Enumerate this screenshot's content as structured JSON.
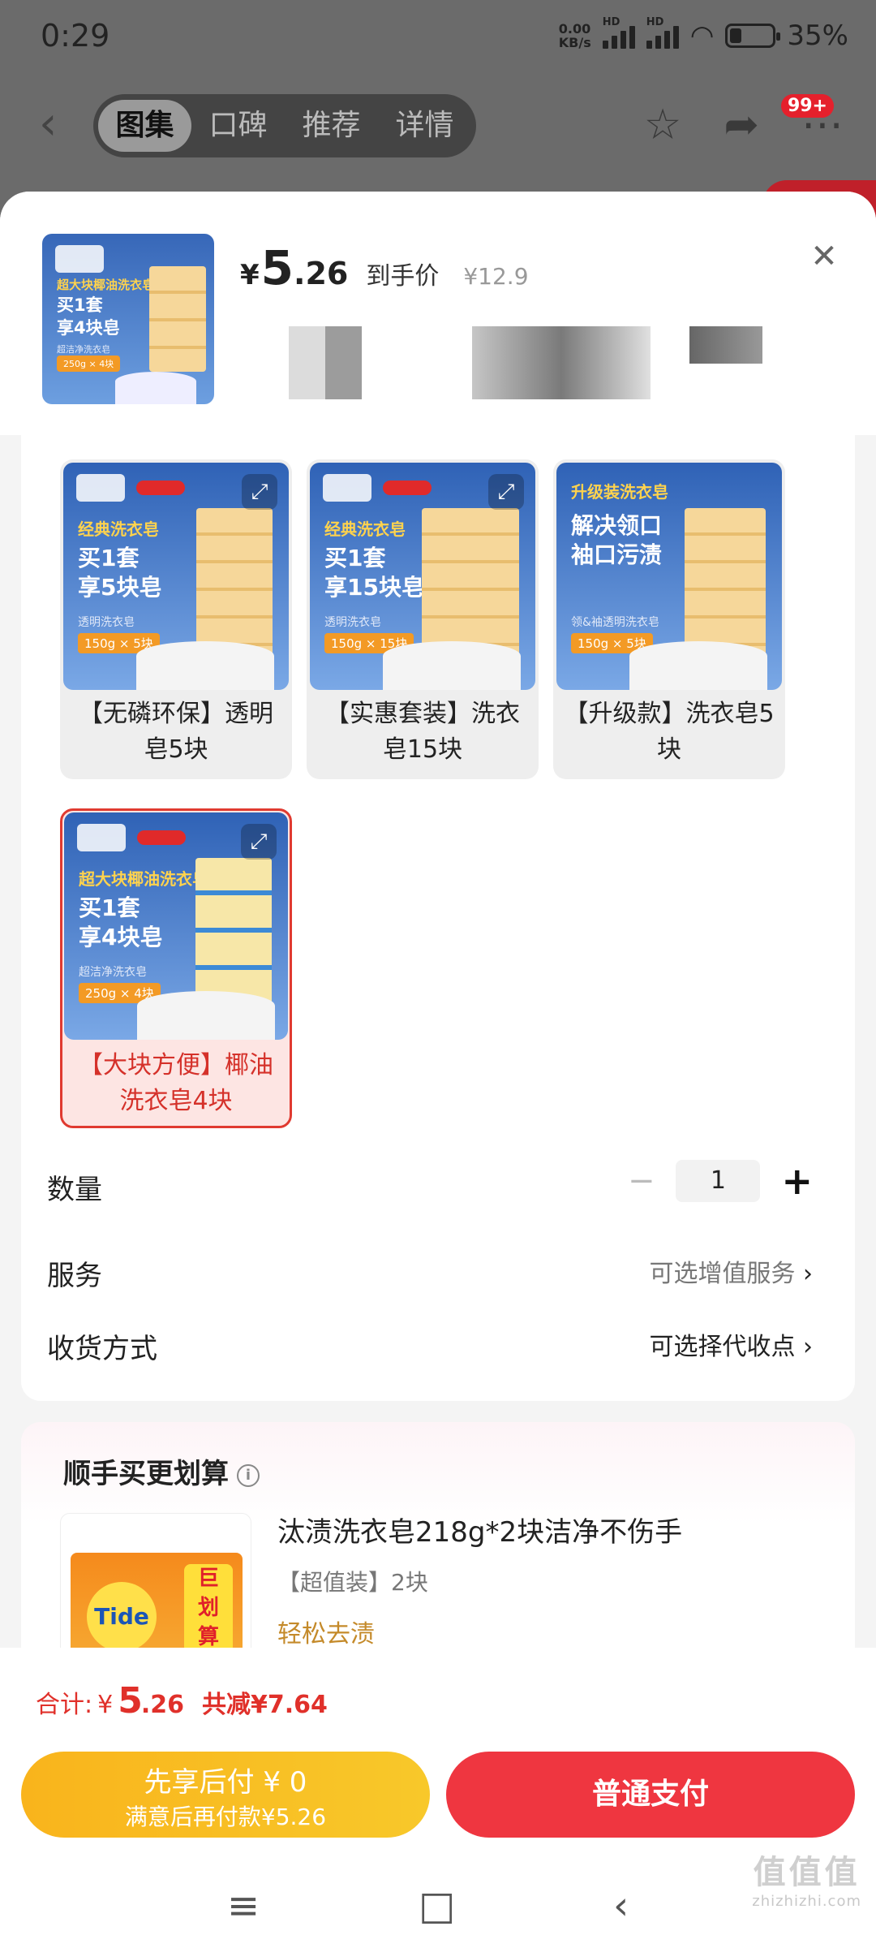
{
  "status": {
    "time": "0:29",
    "net_speed": "0.00\nKB/s",
    "hd1": "HD",
    "hd2": "HD",
    "battery": "35%"
  },
  "nav": {
    "back": "‹",
    "tabs": [
      "图集",
      "口碑",
      "推荐",
      "详情"
    ],
    "active_tab": 0,
    "badge": "99+"
  },
  "header": {
    "currency": "¥",
    "price_int": "5",
    "price_dec": ".26",
    "price_tag": "到手价",
    "orig_price": "¥12.9",
    "close": "✕"
  },
  "thumb": {
    "line1": "超大块椰油洗衣皂",
    "line2": "买1套\n享4块皂",
    "line3": "超洁净洗衣皂",
    "line4": "250g × 4块"
  },
  "options": [
    {
      "label": "【无磷环保】透明皂5块",
      "img_l1": "经典洗衣皂",
      "img_l2": "买1套\n享5块皂",
      "img_l3": "透明洗衣皂",
      "img_l4": "150g × 5块",
      "selected": false
    },
    {
      "label": "【实惠套装】洗衣皂15块",
      "img_l1": "经典洗衣皂",
      "img_l2": "买1套\n享15块皂",
      "img_l3": "透明洗衣皂",
      "img_l4": "150g × 15块",
      "selected": false
    },
    {
      "label": "【升级款】洗衣皂5块",
      "img_l1": "升级装洗衣皂",
      "img_l2": "解决领口\n袖口污渍",
      "img_l3": "领&袖透明洗衣皂",
      "img_l4": "150g × 5块",
      "selected": false
    },
    {
      "label": "【大块方便】椰油洗衣皂4块",
      "img_l1": "超大块椰油洗衣皂",
      "img_l2": "买1套\n享4块皂",
      "img_l3": "超洁净洗衣皂",
      "img_l4": "250g × 4块",
      "selected": true
    }
  ],
  "quantity": {
    "label": "数量",
    "minus": "−",
    "value": "1",
    "plus": "+"
  },
  "service": {
    "label": "服务",
    "value": "可选增值服务",
    "chevron": "›"
  },
  "delivery": {
    "label": "收货方式",
    "value": "可选择代收点",
    "chevron": "›"
  },
  "upsell": {
    "title": "顺手买更划算",
    "info": "i",
    "name": "汰渍洗衣皂218g*2块洁净不伤手",
    "spec": "【超值装】2块",
    "tag": "轻松去渍",
    "img_logo": "Tide",
    "img_tag": "巨\n划\n算"
  },
  "footer": {
    "total_label": "合计:",
    "total_currency": "¥",
    "total_int": "5",
    "total_dec": ".26",
    "saving": "共减¥7.64",
    "pay_later_l1": "先享后付 ¥ 0",
    "pay_later_l2": "满意后再付款¥5.26",
    "pay_now": "普通支付"
  },
  "sysnav": {
    "menu": "≡",
    "home": "□",
    "back": "‹"
  },
  "watermark": {
    "main": "值值值",
    "sub": "zhizhizhi.com"
  },
  "colors": {
    "accent": "#ef3640",
    "pay_later": "#f9b41c",
    "price_red": "#e0302a"
  }
}
